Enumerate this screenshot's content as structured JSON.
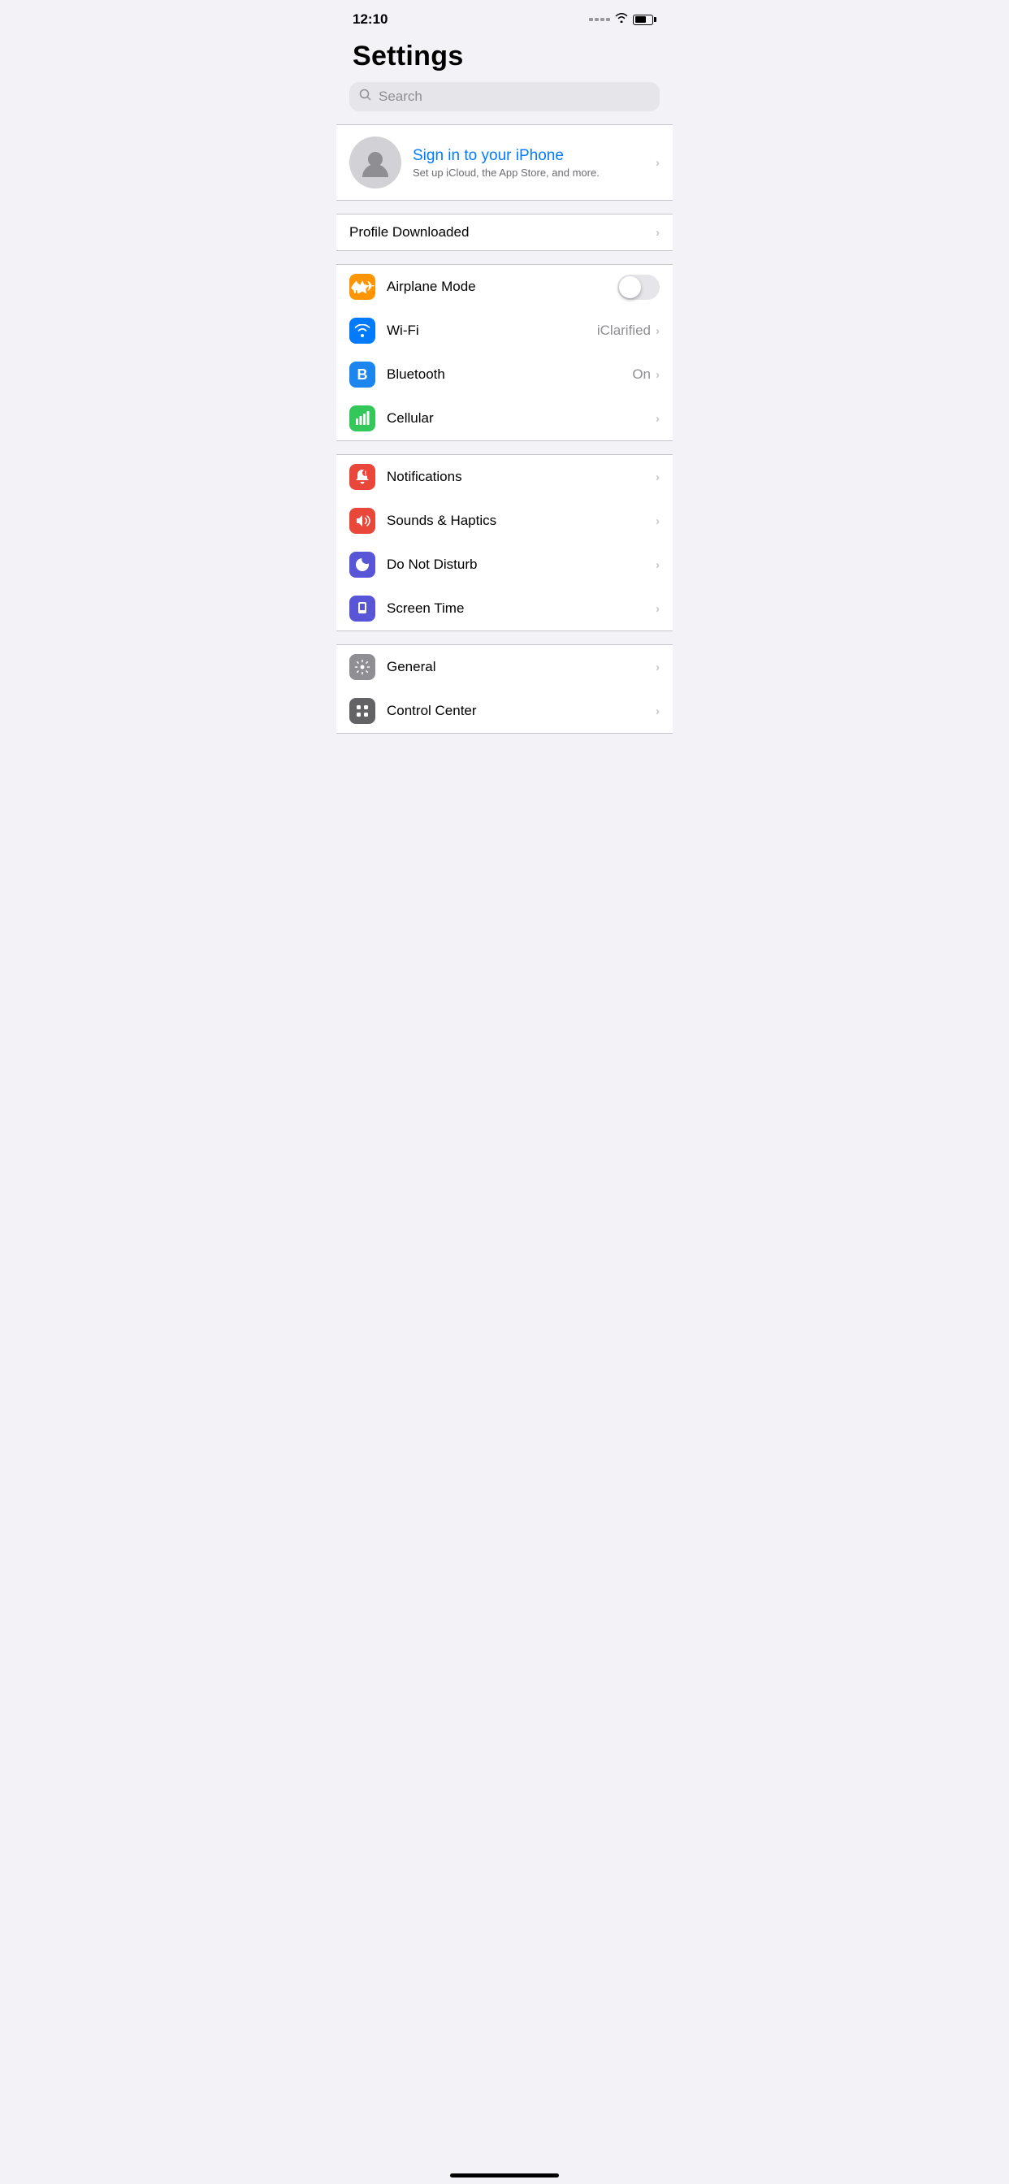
{
  "statusBar": {
    "time": "12:10",
    "signal": "dots",
    "wifi": "wifi",
    "battery": "battery"
  },
  "pageTitle": "Settings",
  "searchBar": {
    "placeholder": "Search"
  },
  "signinSection": {
    "title": "Sign in to your iPhone",
    "subtitle": "Set up iCloud, the App Store, and more."
  },
  "profileSection": {
    "label": "Profile Downloaded",
    "chevron": "›"
  },
  "connectivitySection": [
    {
      "id": "airplane-mode",
      "label": "Airplane Mode",
      "iconColor": "orange",
      "type": "toggle",
      "value": false
    },
    {
      "id": "wifi",
      "label": "Wi-Fi",
      "iconColor": "blue",
      "type": "value",
      "value": "iClarified"
    },
    {
      "id": "bluetooth",
      "label": "Bluetooth",
      "iconColor": "blue-dark",
      "type": "value",
      "value": "On"
    },
    {
      "id": "cellular",
      "label": "Cellular",
      "iconColor": "green",
      "type": "chevron",
      "value": ""
    }
  ],
  "notificationsSection": [
    {
      "id": "notifications",
      "label": "Notifications",
      "iconColor": "red",
      "type": "chevron"
    },
    {
      "id": "sounds-haptics",
      "label": "Sounds & Haptics",
      "iconColor": "red-2",
      "type": "chevron"
    },
    {
      "id": "do-not-disturb",
      "label": "Do Not Disturb",
      "iconColor": "purple",
      "type": "chevron"
    },
    {
      "id": "screen-time",
      "label": "Screen Time",
      "iconColor": "purple-2",
      "type": "chevron"
    }
  ],
  "generalSection": [
    {
      "id": "general",
      "label": "General",
      "iconColor": "gray",
      "type": "chevron"
    },
    {
      "id": "control-center",
      "label": "Control Center",
      "iconColor": "gray-2",
      "type": "chevron"
    }
  ],
  "chevronChar": "›"
}
